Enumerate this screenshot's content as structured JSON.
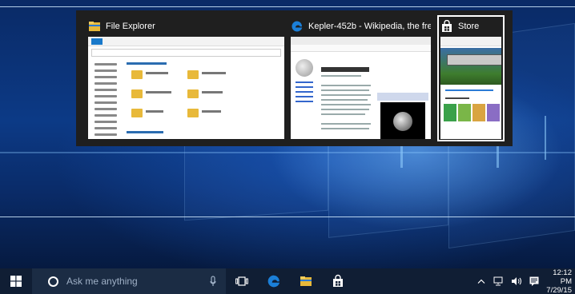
{
  "task_view": {
    "windows": [
      {
        "title": "File Explorer",
        "icon": "file-explorer-icon"
      },
      {
        "title": "Kepler-452b - Wikipedia, the free e...",
        "icon": "edge-icon"
      },
      {
        "title": "Store",
        "icon": "store-icon"
      }
    ]
  },
  "taskbar": {
    "search_placeholder": "Ask me anything",
    "apps": [
      "task-view-icon",
      "edge-icon",
      "file-explorer-icon",
      "store-icon"
    ],
    "tray": {
      "time": "12:12 PM",
      "date": "7/29/15"
    }
  },
  "colors": {
    "taskbar_bg": "#101e34",
    "taskview_bg": "#1f1f1f",
    "edge_blue": "#1b7fd8",
    "folder_yellow": "#e8b93a"
  }
}
